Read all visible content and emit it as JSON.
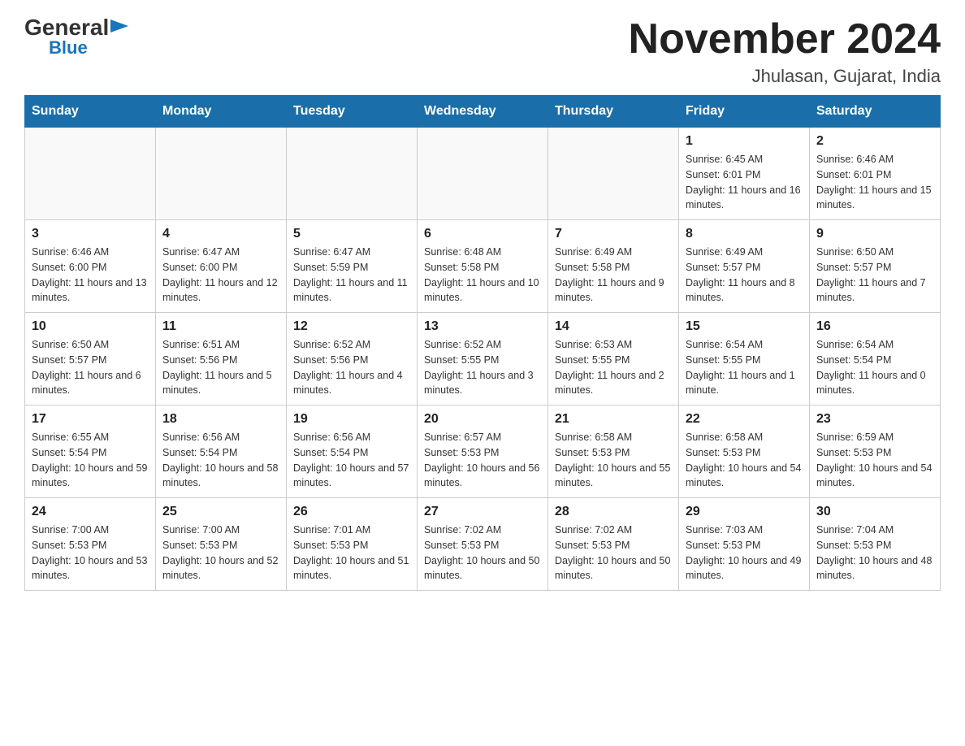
{
  "logo": {
    "general": "General",
    "arrow": "▶",
    "blue": "Blue"
  },
  "title": "November 2024",
  "location": "Jhulasan, Gujarat, India",
  "days_of_week": [
    "Sunday",
    "Monday",
    "Tuesday",
    "Wednesday",
    "Thursday",
    "Friday",
    "Saturday"
  ],
  "weeks": [
    [
      {
        "day": "",
        "info": ""
      },
      {
        "day": "",
        "info": ""
      },
      {
        "day": "",
        "info": ""
      },
      {
        "day": "",
        "info": ""
      },
      {
        "day": "",
        "info": ""
      },
      {
        "day": "1",
        "info": "Sunrise: 6:45 AM\nSunset: 6:01 PM\nDaylight: 11 hours and 16 minutes."
      },
      {
        "day": "2",
        "info": "Sunrise: 6:46 AM\nSunset: 6:01 PM\nDaylight: 11 hours and 15 minutes."
      }
    ],
    [
      {
        "day": "3",
        "info": "Sunrise: 6:46 AM\nSunset: 6:00 PM\nDaylight: 11 hours and 13 minutes."
      },
      {
        "day": "4",
        "info": "Sunrise: 6:47 AM\nSunset: 6:00 PM\nDaylight: 11 hours and 12 minutes."
      },
      {
        "day": "5",
        "info": "Sunrise: 6:47 AM\nSunset: 5:59 PM\nDaylight: 11 hours and 11 minutes."
      },
      {
        "day": "6",
        "info": "Sunrise: 6:48 AM\nSunset: 5:58 PM\nDaylight: 11 hours and 10 minutes."
      },
      {
        "day": "7",
        "info": "Sunrise: 6:49 AM\nSunset: 5:58 PM\nDaylight: 11 hours and 9 minutes."
      },
      {
        "day": "8",
        "info": "Sunrise: 6:49 AM\nSunset: 5:57 PM\nDaylight: 11 hours and 8 minutes."
      },
      {
        "day": "9",
        "info": "Sunrise: 6:50 AM\nSunset: 5:57 PM\nDaylight: 11 hours and 7 minutes."
      }
    ],
    [
      {
        "day": "10",
        "info": "Sunrise: 6:50 AM\nSunset: 5:57 PM\nDaylight: 11 hours and 6 minutes."
      },
      {
        "day": "11",
        "info": "Sunrise: 6:51 AM\nSunset: 5:56 PM\nDaylight: 11 hours and 5 minutes."
      },
      {
        "day": "12",
        "info": "Sunrise: 6:52 AM\nSunset: 5:56 PM\nDaylight: 11 hours and 4 minutes."
      },
      {
        "day": "13",
        "info": "Sunrise: 6:52 AM\nSunset: 5:55 PM\nDaylight: 11 hours and 3 minutes."
      },
      {
        "day": "14",
        "info": "Sunrise: 6:53 AM\nSunset: 5:55 PM\nDaylight: 11 hours and 2 minutes."
      },
      {
        "day": "15",
        "info": "Sunrise: 6:54 AM\nSunset: 5:55 PM\nDaylight: 11 hours and 1 minute."
      },
      {
        "day": "16",
        "info": "Sunrise: 6:54 AM\nSunset: 5:54 PM\nDaylight: 11 hours and 0 minutes."
      }
    ],
    [
      {
        "day": "17",
        "info": "Sunrise: 6:55 AM\nSunset: 5:54 PM\nDaylight: 10 hours and 59 minutes."
      },
      {
        "day": "18",
        "info": "Sunrise: 6:56 AM\nSunset: 5:54 PM\nDaylight: 10 hours and 58 minutes."
      },
      {
        "day": "19",
        "info": "Sunrise: 6:56 AM\nSunset: 5:54 PM\nDaylight: 10 hours and 57 minutes."
      },
      {
        "day": "20",
        "info": "Sunrise: 6:57 AM\nSunset: 5:53 PM\nDaylight: 10 hours and 56 minutes."
      },
      {
        "day": "21",
        "info": "Sunrise: 6:58 AM\nSunset: 5:53 PM\nDaylight: 10 hours and 55 minutes."
      },
      {
        "day": "22",
        "info": "Sunrise: 6:58 AM\nSunset: 5:53 PM\nDaylight: 10 hours and 54 minutes."
      },
      {
        "day": "23",
        "info": "Sunrise: 6:59 AM\nSunset: 5:53 PM\nDaylight: 10 hours and 54 minutes."
      }
    ],
    [
      {
        "day": "24",
        "info": "Sunrise: 7:00 AM\nSunset: 5:53 PM\nDaylight: 10 hours and 53 minutes."
      },
      {
        "day": "25",
        "info": "Sunrise: 7:00 AM\nSunset: 5:53 PM\nDaylight: 10 hours and 52 minutes."
      },
      {
        "day": "26",
        "info": "Sunrise: 7:01 AM\nSunset: 5:53 PM\nDaylight: 10 hours and 51 minutes."
      },
      {
        "day": "27",
        "info": "Sunrise: 7:02 AM\nSunset: 5:53 PM\nDaylight: 10 hours and 50 minutes."
      },
      {
        "day": "28",
        "info": "Sunrise: 7:02 AM\nSunset: 5:53 PM\nDaylight: 10 hours and 50 minutes."
      },
      {
        "day": "29",
        "info": "Sunrise: 7:03 AM\nSunset: 5:53 PM\nDaylight: 10 hours and 49 minutes."
      },
      {
        "day": "30",
        "info": "Sunrise: 7:04 AM\nSunset: 5:53 PM\nDaylight: 10 hours and 48 minutes."
      }
    ]
  ]
}
